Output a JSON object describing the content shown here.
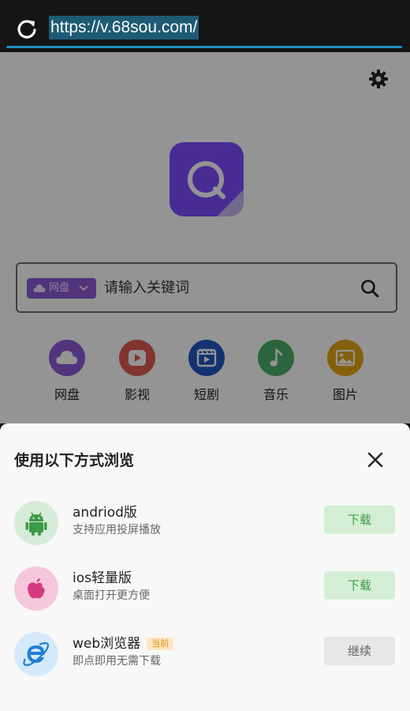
{
  "address_bar": {
    "url": "https://v.68sou.com/"
  },
  "search": {
    "scope": "网盘",
    "placeholder": "请输入关键词"
  },
  "categories": [
    {
      "label": "网盘",
      "icon": "cloud-icon",
      "color": "#8d5bd6"
    },
    {
      "label": "影视",
      "icon": "play-icon",
      "color": "#e05a55"
    },
    {
      "label": "短剧",
      "icon": "video-icon",
      "color": "#2357c5"
    },
    {
      "label": "音乐",
      "icon": "music-note-icon",
      "color": "#4aae6a"
    },
    {
      "label": "图片",
      "icon": "image-icon",
      "color": "#e6a512"
    }
  ],
  "sheet": {
    "title": "使用以下方式浏览",
    "options": [
      {
        "name": "andriod版",
        "desc": "支持应用投屏播放",
        "action": "下载",
        "icon": "android-icon",
        "badge": ""
      },
      {
        "name": "ios轻量版",
        "desc": "桌面打开更方便",
        "action": "下载",
        "icon": "apple-icon",
        "badge": ""
      },
      {
        "name": "web浏览器",
        "desc": "即点即用无需下载",
        "action": "继续",
        "icon": "ie-browser-icon",
        "badge": "当前"
      }
    ]
  },
  "colors": {
    "accent": "#7c4dff",
    "download": "#3d9a46",
    "url_highlight": "#1e5a74"
  }
}
